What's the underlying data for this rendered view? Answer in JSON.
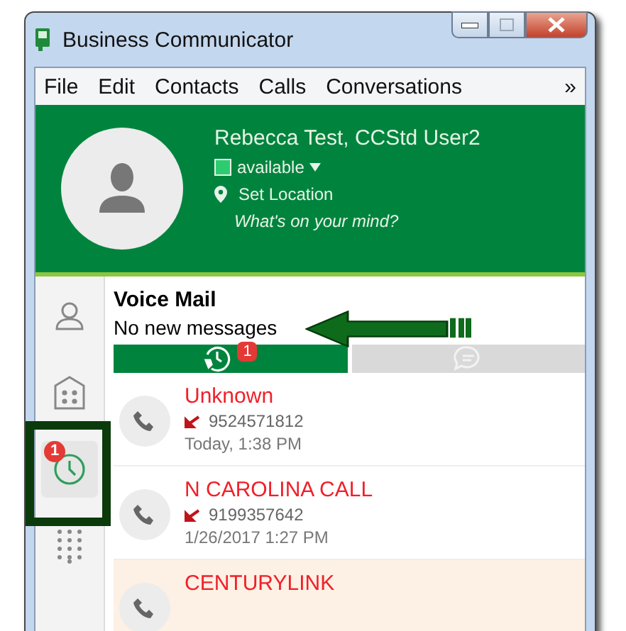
{
  "window": {
    "title": "Business Communicator"
  },
  "menu": [
    {
      "label": "File"
    },
    {
      "label": "Edit"
    },
    {
      "label": "Contacts"
    },
    {
      "label": "Calls"
    },
    {
      "label": "Conversations"
    },
    {
      "label": "»"
    }
  ],
  "profile": {
    "name": "Rebecca Test, CCStd User2",
    "status": "available",
    "location": "Set Location",
    "mood": "What's on your mind?"
  },
  "rail": [
    {
      "kind": "contacts",
      "selected": false
    },
    {
      "kind": "apps",
      "selected": false
    },
    {
      "kind": "recent",
      "selected": true,
      "badge": "1"
    },
    {
      "kind": "dialpad",
      "selected": false
    }
  ],
  "section": {
    "title": "Voice Mail",
    "subtitle": "No new messages"
  },
  "tabs": [
    {
      "kind": "calls",
      "selected": true,
      "badge": "1"
    },
    {
      "kind": "chat",
      "selected": false
    }
  ],
  "calls": [
    {
      "name": "Unknown",
      "number": "9524571812",
      "time": "Today, 1:38 PM",
      "highlighted": false
    },
    {
      "name": "N CAROLINA CALL",
      "number": "9199357642",
      "time": "1/26/2017 1:27 PM",
      "highlighted": false
    },
    {
      "name": "CENTURYLINK",
      "highlighted": true
    }
  ]
}
